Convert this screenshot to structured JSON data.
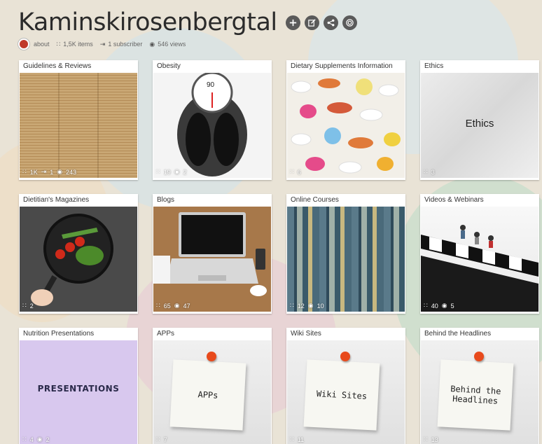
{
  "header": {
    "title": "Kaminskirosenbergtal",
    "meta": {
      "about": "about",
      "items": "1,5K items",
      "subscribers": "1 subscriber",
      "views": "546 views"
    },
    "actions": [
      "plus-icon",
      "edit-icon",
      "share-icon",
      "target-icon"
    ]
  },
  "tiles": [
    {
      "label": "Guidelines & Reviews",
      "stats": [
        "1K",
        "1",
        "243"
      ]
    },
    {
      "label": "Obesity",
      "stats": [
        "19",
        "2"
      ]
    },
    {
      "label": "Dietary Supplements Information",
      "stats": [
        "6"
      ]
    },
    {
      "label": "Ethics",
      "stats": [
        "3"
      ],
      "image_text": "Ethics"
    },
    {
      "label": "Dietitian's Magazines",
      "stats": [
        "2"
      ]
    },
    {
      "label": "Blogs",
      "stats": [
        "65",
        "47"
      ]
    },
    {
      "label": "Online Courses",
      "stats": [
        "12",
        "10"
      ]
    },
    {
      "label": "Videos & Webinars",
      "stats": [
        "40",
        "5"
      ]
    },
    {
      "label": "Nutrition Presentations",
      "stats": [
        "4",
        "2"
      ],
      "image_text": "PRESENTATIONS"
    },
    {
      "label": "APPs",
      "stats": [
        "7"
      ],
      "image_text": "APPs"
    },
    {
      "label": "Wiki Sites",
      "stats": [
        "11"
      ],
      "image_text": "Wiki Sites"
    },
    {
      "label": "Behind the Headlines",
      "stats": [
        "13"
      ],
      "image_text": "Behind the Headlines"
    }
  ],
  "colors": {
    "background": "#e9e3d6",
    "title": "#2b2b2b",
    "presentations_bg": "#d8c8ee",
    "pin": "#e84a1c"
  }
}
